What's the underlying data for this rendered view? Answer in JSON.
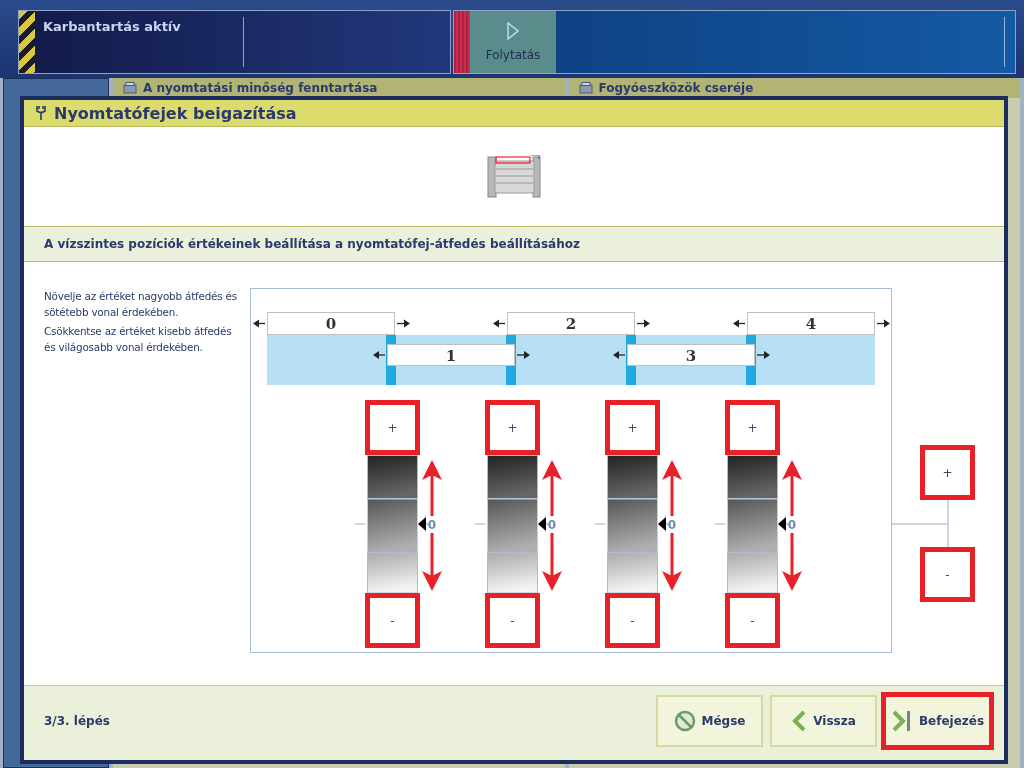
{
  "status_bar": {
    "title": "Karbantartás aktív",
    "continue_button": "Folytatás"
  },
  "background_tabs": [
    {
      "label": "A nyomtatási minőség fenntartása"
    },
    {
      "label": "Fogyóeszközök cseréje"
    }
  ],
  "dialog": {
    "title": "Nyomtatófejek beigazítása",
    "subtitle": "A vízszintes pozíciók értékeinek beállítása a nyomtatófej-átfedés beállításához",
    "instructions": [
      "Növelje az értéket nagyobb átfedés és sötétebb vonal érdekében.",
      "Csökkentse az értéket kisebb átfedés és világosabb vonal érdekében."
    ],
    "heads": [
      "0",
      "1",
      "2",
      "3",
      "4"
    ],
    "adjusters": [
      {
        "value": "0",
        "plus": "+",
        "minus": "-"
      },
      {
        "value": "0",
        "plus": "+",
        "minus": "-"
      },
      {
        "value": "0",
        "plus": "+",
        "minus": "-"
      },
      {
        "value": "0",
        "plus": "+",
        "minus": "-"
      }
    ],
    "global_adjuster": {
      "plus": "+",
      "minus": "-"
    },
    "step": "3/3. lépés",
    "buttons": [
      {
        "kind": "cancel",
        "label": "Mégse",
        "highlighted": false
      },
      {
        "kind": "back",
        "label": "Vissza",
        "highlighted": false
      },
      {
        "kind": "finish",
        "label": "Befejezés",
        "highlighted": true
      }
    ]
  }
}
